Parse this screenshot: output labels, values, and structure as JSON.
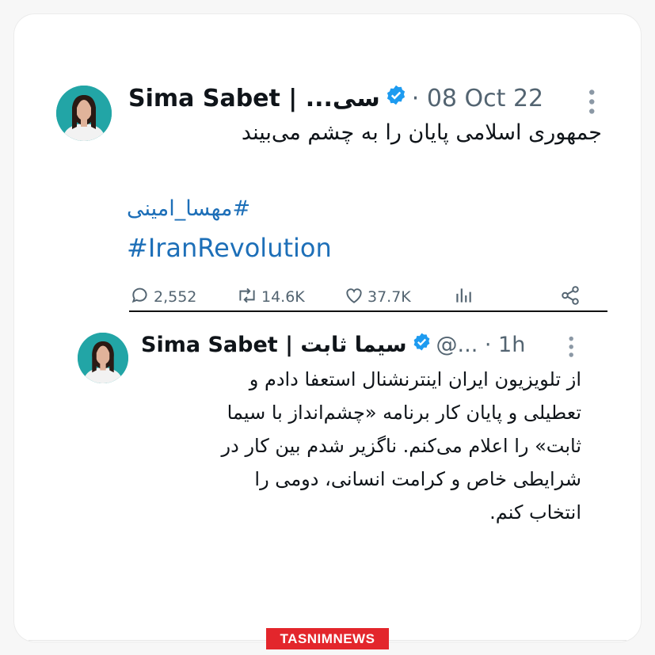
{
  "tweet1": {
    "display_name": "Sima Sabet | ...سی",
    "date": "· 08 Oct 22",
    "text": "جمهوری اسلامی پایان را به چشم می‌بیند",
    "hashtags": [
      "#مهسا_امینی",
      "#IranRevolution"
    ],
    "actions": {
      "replies": "2,552",
      "retweets": "14.6K",
      "likes": "37.7K"
    }
  },
  "tweet2": {
    "display_name": "Sima Sabet | سیما ثابت",
    "meta": "@... · 1h",
    "text_lines": [
      "از تلویزیون ایران اینترنشنال استعفا دادم و",
      "تعطیلی و پایان کار برنامه «چشم‌انداز با سیما",
      "ثابت» را  اعلام می‌کنم. ناگزیر شدم بین کار در",
      "شرایطی خاص و کرامت انسانی، دومی را",
      "انتخاب کنم."
    ]
  },
  "branding": {
    "logo": "TASNIMNEWS"
  },
  "colors": {
    "link": "#1d6fb8",
    "verified": "#1d9bf0",
    "logo_bg": "#e3262c"
  },
  "icons": [
    "reply-icon",
    "retweet-icon",
    "like-icon",
    "views-icon",
    "share-icon",
    "verified-icon",
    "more-icon"
  ]
}
